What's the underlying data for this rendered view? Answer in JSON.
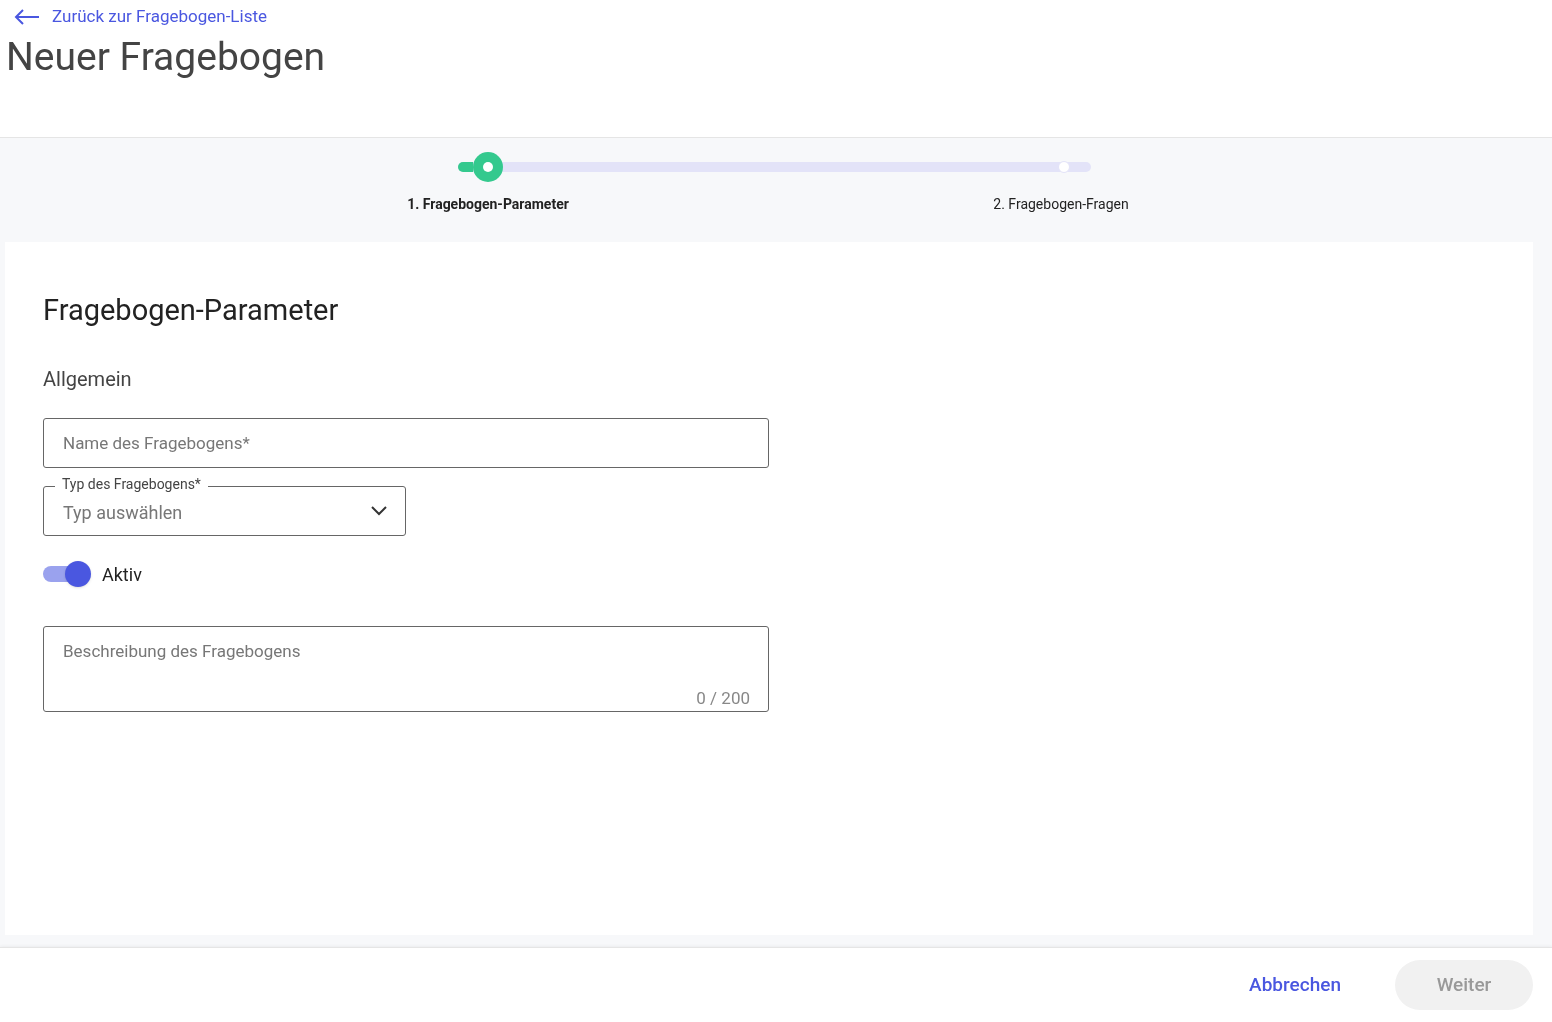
{
  "back_link": {
    "label": "Zurück zur Fragebogen-Liste"
  },
  "page_title": "Neuer Fragebogen",
  "stepper": {
    "steps": [
      {
        "label": "1. Fragebogen-Parameter",
        "selected": true
      },
      {
        "label": "2. Fragebogen-Fragen",
        "selected": false
      }
    ]
  },
  "form": {
    "title": "Fragebogen-Parameter",
    "section": "Allgemein",
    "name_field": {
      "placeholder": "Name des Fragebogens*"
    },
    "type_select": {
      "label": "Typ des Fragebogens*",
      "placeholder": "Typ auswählen"
    },
    "active_toggle": {
      "label": "Aktiv",
      "on": true
    },
    "description_field": {
      "placeholder": "Beschreibung des Fragebogens",
      "counter": "0 / 200"
    }
  },
  "footer": {
    "cancel": "Abbrechen",
    "next": {
      "label": "Weiter",
      "disabled": true
    }
  }
}
